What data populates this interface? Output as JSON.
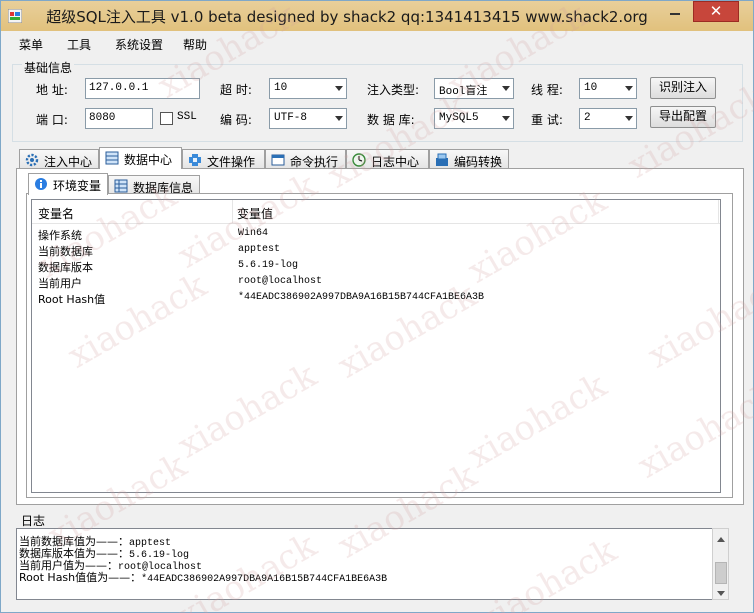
{
  "window": {
    "title": "超级SQL注入工具 v1.0 beta designed by shack2 qq:1341413415 www.shack2.org",
    "close_glyph": "✕"
  },
  "menu": [
    "菜单",
    "工具",
    "系统设置",
    "帮助"
  ],
  "basic": {
    "legend": "基础信息",
    "address_label": "地 址:",
    "address_value": "127.0.0.1",
    "timeout_label": "超 时:",
    "timeout_value": "10",
    "inject_type_label": "注入类型:",
    "inject_type_value": "Bool盲注",
    "threads_label": "线 程:",
    "threads_value": "10",
    "identify_button": "识别注入",
    "port_label": "端 口:",
    "port_value": "8080",
    "ssl_label": "SSL",
    "ssl_checked": false,
    "encoding_label": "编 码:",
    "encoding_value": "UTF-8",
    "db_label": "数 据 库:",
    "db_value": "MySQL5",
    "retry_label": "重 试:",
    "retry_value": "2",
    "export_button": "导出配置"
  },
  "tabs": [
    {
      "label": "注入中心",
      "icon": "gear-icon"
    },
    {
      "label": "数据中心",
      "icon": "database-icon",
      "active": true
    },
    {
      "label": "文件操作",
      "icon": "file-plus-icon"
    },
    {
      "label": "命令执行",
      "icon": "window-icon"
    },
    {
      "label": "日志中心",
      "icon": "clock-icon"
    },
    {
      "label": "编码转换",
      "icon": "convert-icon"
    }
  ],
  "subtabs": [
    {
      "label": "环境变量",
      "icon": "info-icon",
      "active": true
    },
    {
      "label": "数据库信息",
      "icon": "table-icon"
    }
  ],
  "env_table": {
    "columns": [
      "变量名",
      "变量值"
    ],
    "rows": [
      [
        "操作系统",
        "Win64"
      ],
      [
        "当前数据库",
        "apptest"
      ],
      [
        "数据库版本",
        "5.6.19-log"
      ],
      [
        "当前用户",
        "root@localhost"
      ],
      [
        "Root Hash值",
        "*44EADC386902A997DBA9A16B15B744CFA1BE6A3B"
      ]
    ]
  },
  "log": {
    "label": "日志",
    "lines": [
      [
        "当前数据库值为——：",
        "apptest"
      ],
      [
        "数据库版本值为——：",
        "5.6.19-log"
      ],
      [
        "当前用户值为——：",
        "root@localhost"
      ],
      [
        "Root Hash值值为——：",
        "*44EADC386902A997DBA9A16B15B744CFA1BE6A3B"
      ]
    ]
  },
  "watermark": "xiaohack"
}
